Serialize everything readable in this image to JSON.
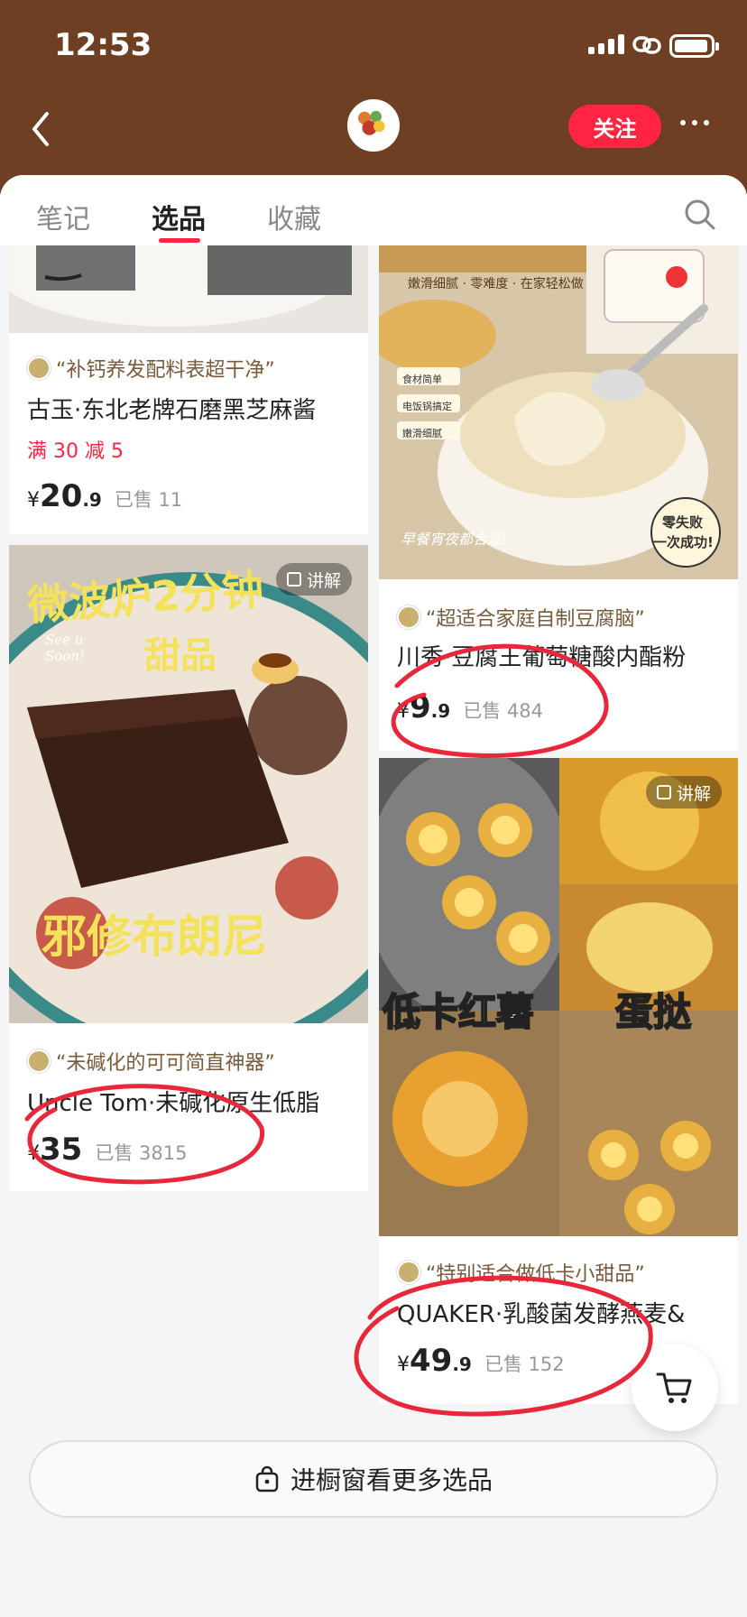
{
  "status_bar": {
    "time": "12:53"
  },
  "header": {
    "follow_label": "关注"
  },
  "tabs": [
    {
      "label": "笔记",
      "active": false
    },
    {
      "label": "选品",
      "active": true
    },
    {
      "label": "收藏",
      "active": false
    }
  ],
  "products": [
    {
      "quote": "“补钙养发配料表超干净”",
      "title": "古玉·东北老牌石磨黑芝麻酱",
      "promo": "满 30 减 5",
      "price_symbol": "¥",
      "price_int": "20",
      "price_dec": ".9",
      "sold": "已售 11"
    },
    {
      "quote": "“超适合家庭自制豆腐脑”",
      "title": "川秀·豆腐王葡萄糖酸内酯粉",
      "price_symbol": "¥",
      "price_int": "9",
      "price_dec": ".9",
      "sold": "已售 484",
      "image_text": {
        "line1": "嫩滑细腻 · 零难度 · 在家轻松做",
        "tag1": "食材简单",
        "tag2": "电饭锅搞定",
        "tag3": "嫩滑细腻",
        "bottom": "早餐宵夜都合适!",
        "badge1": "零失败",
        "badge2": "一次成功!"
      }
    },
    {
      "quote": "“未碱化的可可简直神器”",
      "title": "Uncle Tom·未碱化原生低脂",
      "price_symbol": "¥",
      "price_int": "35",
      "price_dec": "",
      "sold": "已售 3815",
      "explain": "讲解",
      "image_text": {
        "top": "微波炉2分钟",
        "mid": "甜品",
        "script": "See u Soon!",
        "bottom": "邪修布朗尼"
      }
    },
    {
      "quote": "“特别适合做低卡小甜品”",
      "title": "QUAKER·乳酸菌发酵燕麦&",
      "price_symbol": "¥",
      "price_int": "49",
      "price_dec": ".9",
      "sold": "已售 152",
      "explain": "讲解",
      "image_text": {
        "left": "低卡红薯",
        "right": "蛋挞"
      }
    }
  ],
  "more_button": {
    "label": "进橱窗看更多选品"
  },
  "colors": {
    "header_bg": "#6e3f22",
    "accent": "#ff2442",
    "scribble": "#e8283a"
  },
  "icons": [
    "back-icon",
    "search-icon",
    "shopping-bag-icon",
    "cart-icon",
    "more-icon",
    "explain-icon"
  ]
}
